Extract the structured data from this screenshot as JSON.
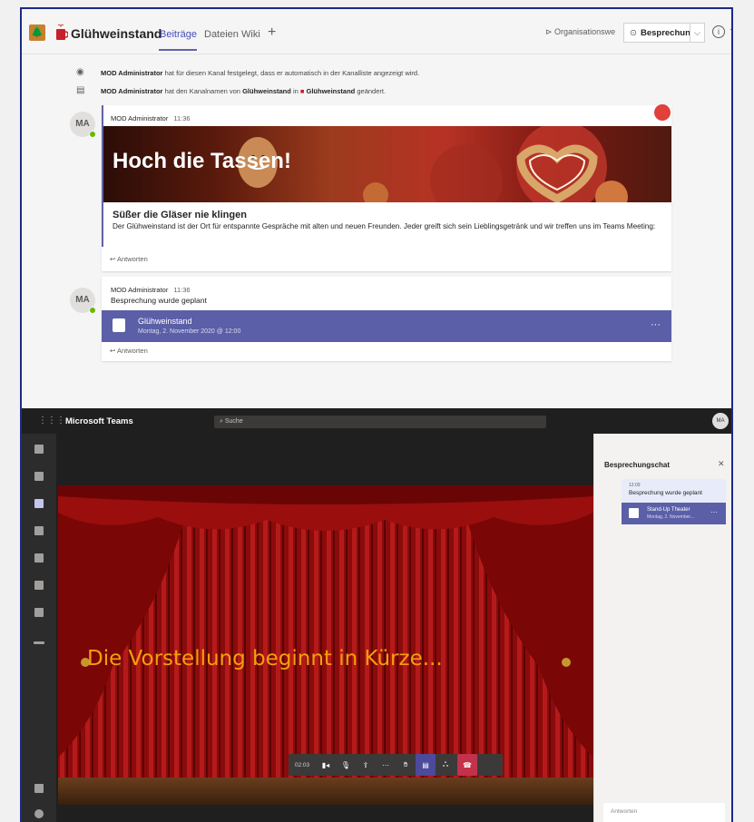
{
  "channel": {
    "team_name": "Glühweinstand",
    "tabs": [
      "Beiträge",
      "Dateien",
      "Wiki"
    ],
    "add_tab": "+",
    "org_label": "Organisationswe",
    "meet_label": "Besprechung",
    "sys_messages": [
      {
        "author": "MOD Administrator",
        "text": "hat für diesen Kanal festgelegt, dass er automatisch in der Kanalliste angezeigt wird."
      },
      {
        "author": "MOD Administrator",
        "text_a": "hat den Kanalnamen von",
        "from": "Glühweinstand",
        "text_b": "in",
        "to": "Glühweinstand",
        "text_c": "geändert."
      }
    ],
    "post1": {
      "avatar": "MA",
      "author": "MOD Administrator",
      "time": "11:36",
      "hero_title": "Hoch die Tassen!",
      "card_title": "Süßer die Gläser nie klingen",
      "card_body": "Der Glühweinstand ist der Ort für entspannte Gespräche mit alten und neuen Freunden. Jeder greift sich sein Lieblingsgetränk und wir treffen uns im Teams Meeting:",
      "reply": "Antworten"
    },
    "post2": {
      "avatar": "MA",
      "author": "MOD Administrator",
      "time": "11:36",
      "text": "Besprechung wurde geplant",
      "event_title": "Glühweinstand",
      "event_date": "Montag, 2. November 2020 @ 12:00",
      "reply": "Antworten"
    }
  },
  "meeting": {
    "brand": "Microsoft Teams",
    "search": "Suche",
    "avatar": "MA",
    "stage_text": "Die Vorstellung beginnt in Kürze...",
    "timer": "02:03",
    "chat": {
      "title": "Besprechungschat",
      "time": "12:09",
      "text": "Besprechung wurde geplant",
      "event_title": "Stand-Up Theater",
      "event_date": "Montag, 2. November...",
      "reply_placeholder": "Antworten"
    }
  },
  "colors": {
    "accent": "#6264a7",
    "event_banner": "#5b5fa7",
    "stage_text": "#f2a00b",
    "hangup": "#c4314b"
  }
}
